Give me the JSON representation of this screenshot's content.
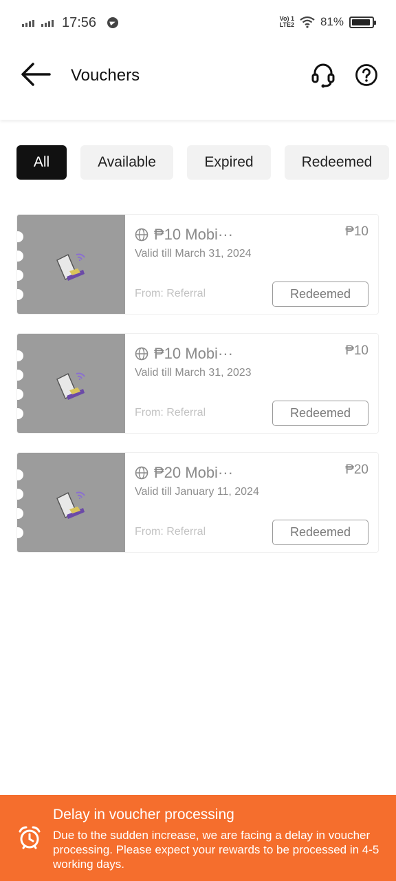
{
  "status_bar": {
    "time": "17:56",
    "network_label": "Vo) 1\nLTE2",
    "battery_percent": "81%",
    "battery_level": 0.81,
    "icons": [
      "signal-icon",
      "signal-icon",
      "telegram-icon",
      "volte-icon",
      "wifi-icon",
      "battery-icon"
    ]
  },
  "header": {
    "title": "Vouchers",
    "back_icon": "back-arrow-icon",
    "support_icon": "headset-icon",
    "help_icon": "help-icon"
  },
  "tabs": [
    {
      "label": "All",
      "active": true
    },
    {
      "label": "Available",
      "active": false
    },
    {
      "label": "Expired",
      "active": false
    },
    {
      "label": "Redeemed",
      "active": false
    }
  ],
  "vouchers": [
    {
      "name": "₱10 Mobi···",
      "price": "₱10",
      "valid": "Valid till March 31, 2024",
      "from": "From: Referral",
      "action": "Redeemed"
    },
    {
      "name": "₱10 Mobi···",
      "price": "₱10",
      "valid": "Valid till March 31, 2023",
      "from": "From: Referral",
      "action": "Redeemed"
    },
    {
      "name": "₱20 Mobi···",
      "price": "₱20",
      "valid": "Valid till January 11, 2024",
      "from": "From: Referral",
      "action": "Redeemed"
    }
  ],
  "banner": {
    "title": "Delay in voucher processing",
    "body": "Due to the sudden increase, we are facing a delay in voucher processing. Please expect your rewards to be processed in 4-5 working days.",
    "icon": "alarm-clock-icon"
  },
  "colors": {
    "banner_bg": "#f56e2d",
    "active_tab_bg": "#111111",
    "thumb_bg": "#9c9c9c"
  }
}
